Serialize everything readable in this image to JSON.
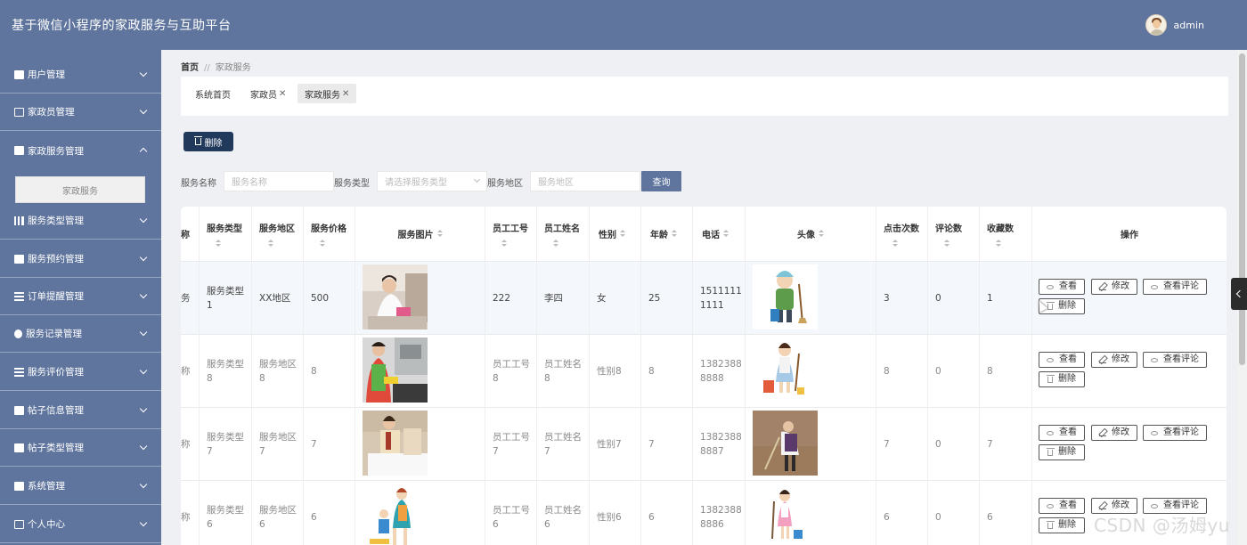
{
  "header": {
    "title": "基于微信小程序的家政服务与互助平台",
    "username": "admin"
  },
  "sidebar": {
    "items": [
      {
        "label": "用户管理",
        "icon": "grid-icon"
      },
      {
        "label": "家政员管理",
        "icon": "person-card-icon"
      },
      {
        "label": "家政服务管理",
        "icon": "grid-icon",
        "expanded": true
      },
      {
        "label": "服务类型管理",
        "icon": "bar-icon"
      },
      {
        "label": "服务预约管理",
        "icon": "briefcase-icon"
      },
      {
        "label": "订单提醒管理",
        "icon": "sliders-icon"
      },
      {
        "label": "服务记录管理",
        "icon": "bulb-icon"
      },
      {
        "label": "服务评价管理",
        "icon": "list-icon"
      },
      {
        "label": "帖子信息管理",
        "icon": "grid-icon"
      },
      {
        "label": "帖子类型管理",
        "icon": "clipboard-icon"
      },
      {
        "label": "系统管理",
        "icon": "grid-icon"
      },
      {
        "label": "个人中心",
        "icon": "window-icon"
      }
    ],
    "sub_item": "家政服务"
  },
  "breadcrumb": {
    "home": "首页",
    "sep": "//",
    "current": "家政服务"
  },
  "tags": [
    {
      "label": "系统首页",
      "closable": false
    },
    {
      "label": "家政员",
      "closable": true
    },
    {
      "label": "家政服务",
      "closable": true,
      "active": true
    }
  ],
  "toolbar": {
    "delete_label": "删除"
  },
  "search": {
    "fields": [
      {
        "label": "服务名称",
        "placeholder": "服务名称"
      },
      {
        "label": "服务类型",
        "placeholder": "请选择服务类型"
      },
      {
        "label": "服务地区",
        "placeholder": "服务地区"
      }
    ],
    "query_label": "查询"
  },
  "table": {
    "headers": {
      "name_partial": "名称",
      "type": "服务类型",
      "area": "服务地区",
      "price": "服务价格",
      "image": "服务图片",
      "emp_no": "员工工号",
      "emp_name": "员工姓名",
      "gender": "性别",
      "age": "年龄",
      "phone": "电话",
      "avatar": "头像",
      "clicks": "点击次数",
      "comments": "评论数",
      "favorites": "收藏数",
      "ops": "操作"
    },
    "rows": [
      {
        "name": "务",
        "type": [
          "服务类型",
          "1"
        ],
        "area": [
          "XX地区"
        ],
        "price": "500",
        "emp_no": [
          "222"
        ],
        "emp_name": [
          "李四"
        ],
        "gender": "女",
        "age": "25",
        "phone": [
          "1511111",
          "1111"
        ],
        "clicks": "3",
        "comments": "0",
        "favorites": "1"
      },
      {
        "name": "称",
        "type": [
          "服务类型",
          "8"
        ],
        "area": [
          "服务地区",
          "8"
        ],
        "price": "8",
        "emp_no": [
          "员工工号",
          "8"
        ],
        "emp_name": [
          "员工姓名",
          "8"
        ],
        "gender": "性别8",
        "age": "8",
        "phone": [
          "1382388",
          "8888"
        ],
        "clicks": "8",
        "comments": "0",
        "favorites": "8"
      },
      {
        "name": "称",
        "type": [
          "服务类型",
          "7"
        ],
        "area": [
          "服务地区",
          "7"
        ],
        "price": "7",
        "emp_no": [
          "员工工号",
          "7"
        ],
        "emp_name": [
          "员工姓名",
          "7"
        ],
        "gender": "性别7",
        "age": "7",
        "phone": [
          "1382388",
          "8887"
        ],
        "clicks": "7",
        "comments": "0",
        "favorites": "7"
      },
      {
        "name": "称",
        "type": [
          "服务类型",
          "6"
        ],
        "area": [
          "服务地区",
          "6"
        ],
        "price": "6",
        "emp_no": [
          "员工工号",
          "6"
        ],
        "emp_name": [
          "员工姓名",
          "6"
        ],
        "gender": "性别6",
        "age": "6",
        "phone": [
          "1382388",
          "8886"
        ],
        "clicks": "6",
        "comments": "0",
        "favorites": "6"
      }
    ],
    "actions": {
      "view": "查看",
      "edit": "修改",
      "view_comments": "查看评论",
      "delete": "删除"
    }
  },
  "watermark": "CSDN @汤姆yu",
  "colors": {
    "header_bg": "#5f759d",
    "delete_btn": "#213a5c",
    "query_btn": "#5f759d"
  }
}
